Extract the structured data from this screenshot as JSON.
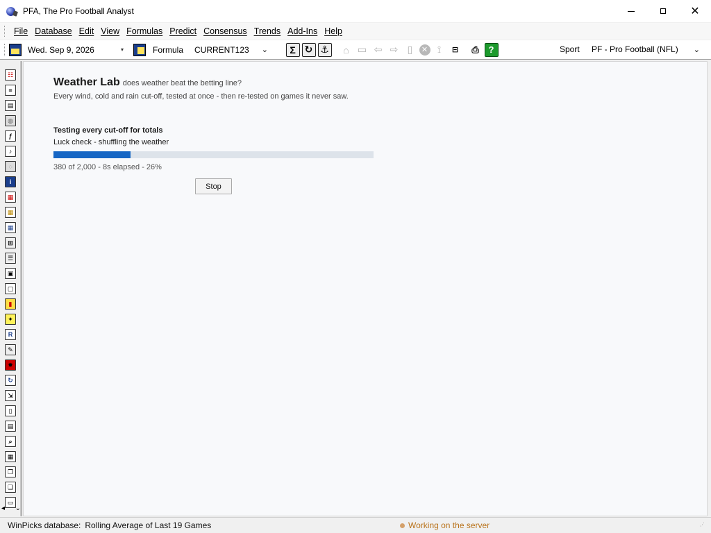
{
  "window": {
    "title": "PFA, The Pro Football Analyst",
    "controls": [
      "minimize",
      "maximize",
      "close"
    ]
  },
  "menu": {
    "items": [
      "File",
      "Database",
      "Edit",
      "View",
      "Formulas",
      "Predict",
      "Consensus",
      "Trends",
      "Add-Ins",
      "Help"
    ]
  },
  "toolbar": {
    "date_value": "Wed. Sep  9, 2026",
    "formula_label": "Formula",
    "formula_value": "CURRENT123",
    "sport_label": "Sport",
    "sport_value": "PF - Pro Football (NFL)",
    "buttons": [
      "sum-icon",
      "refresh-icon",
      "anchor-icon",
      "home-icon",
      "open-folder-icon",
      "back-icon",
      "forward-icon",
      "copy-icon",
      "stop-circle-icon",
      "run-icon",
      "notes-icon",
      "print-icon",
      "help-icon"
    ]
  },
  "leftbar": {
    "icons": [
      "matchup-grid-icon",
      "list-icon",
      "document-icon",
      "globe-icon",
      "formula-fx-icon",
      "music-note-icon",
      "world-icon",
      "info-icon",
      "table-red-icon",
      "table-yellow-icon",
      "table-blue-icon",
      "settings-list-icon",
      "checklist-icon",
      "window-icon",
      "panel-icon",
      "books-icon",
      "lightbulb-icon",
      "ratings-icon",
      "edit-icon",
      "target-icon",
      "cycle-icon",
      "move-icon",
      "page-icon",
      "copy-page-icon",
      "magnifier-icon",
      "calculator-icon",
      "stack-icon",
      "duplicate-icon",
      "clipboard-icon"
    ]
  },
  "lab": {
    "title": "Weather Lab",
    "subtitle": "does weather beat the betting line?",
    "description": "Every wind, cold and rain cut-off, tested at once - then re-tested on games it never saw.",
    "section": "Testing every cut-off for totals",
    "step": "Luck check - shuffling the weather",
    "progress": 0.24,
    "stats": "380 of 2,000 - 8s elapsed - 26%",
    "stop_label": "Stop"
  },
  "statusbar": {
    "db_label": "WinPicks database:",
    "db_value": "Rolling Average of Last 19 Games",
    "status_text": "Working on the server",
    "status_color": "#b9731b"
  }
}
